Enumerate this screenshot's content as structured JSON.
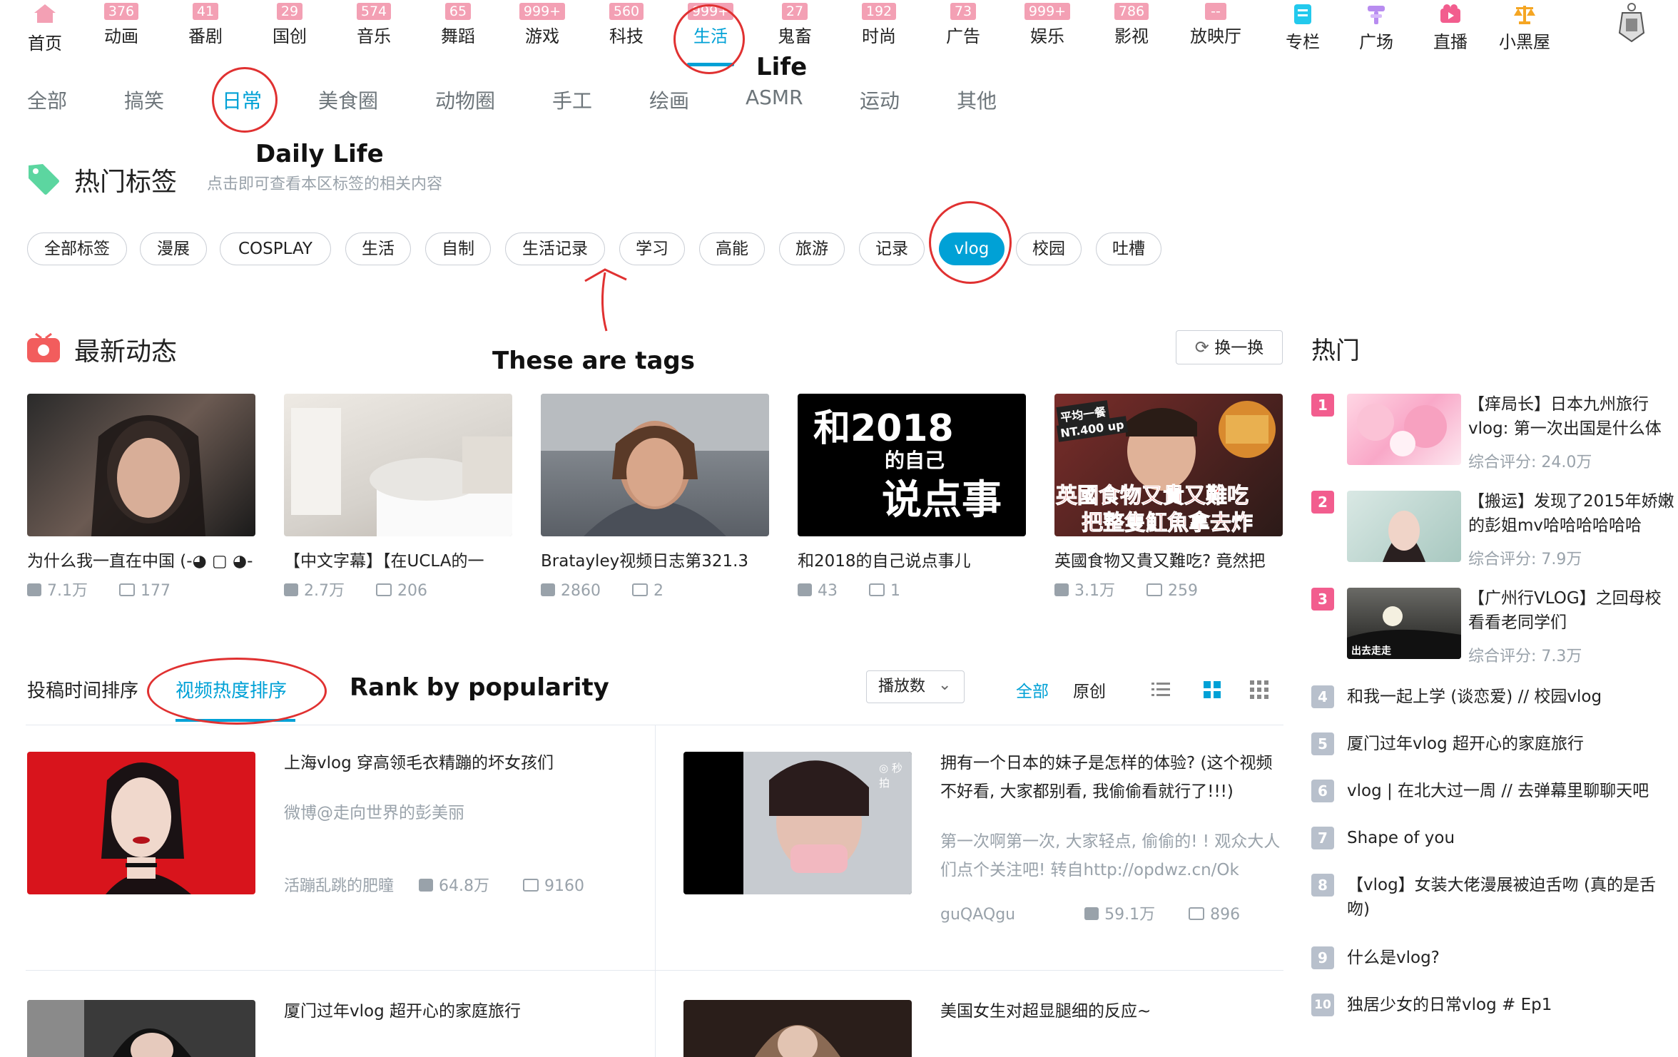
{
  "nav": {
    "items": [
      {
        "label": "首页",
        "badge": ""
      },
      {
        "label": "动画",
        "badge": "376"
      },
      {
        "label": "番剧",
        "badge": "41"
      },
      {
        "label": "国创",
        "badge": "29"
      },
      {
        "label": "音乐",
        "badge": "574"
      },
      {
        "label": "舞蹈",
        "badge": "65"
      },
      {
        "label": "游戏",
        "badge": "999+"
      },
      {
        "label": "科技",
        "badge": "560"
      },
      {
        "label": "生活",
        "badge": "999+"
      },
      {
        "label": "鬼畜",
        "badge": "27"
      },
      {
        "label": "时尚",
        "badge": "192"
      },
      {
        "label": "广告",
        "badge": "73"
      },
      {
        "label": "娱乐",
        "badge": "999+"
      },
      {
        "label": "影视",
        "badge": "786"
      },
      {
        "label": "放映厅",
        "badge": "--"
      },
      {
        "label": "专栏",
        "badge": ""
      },
      {
        "label": "广场",
        "badge": ""
      },
      {
        "label": "直播",
        "badge": ""
      },
      {
        "label": "小黑屋",
        "badge": ""
      }
    ],
    "active_index": 8,
    "accent_color": "#00a1d6",
    "badge_color": "#f3a0b4"
  },
  "subnav": [
    "全部",
    "搞笑",
    "日常",
    "美食圈",
    "动物圈",
    "手工",
    "绘画",
    "ASMR",
    "运动",
    "其他"
  ],
  "annotations": {
    "life": "Life",
    "daily_life": "Daily Life",
    "tags_note": "These are tags",
    "rank_note": "Rank by popularity"
  },
  "hot_tags": {
    "title": "热门标签",
    "subtitle": "点击即可查看本区标签的相关内容",
    "tags": [
      "全部标签",
      "漫展",
      "COSPLAY",
      "生活",
      "自制",
      "生活记录",
      "学习",
      "高能",
      "旅游",
      "记录",
      "vlog",
      "校园",
      "吐槽"
    ],
    "active": "vlog"
  },
  "latest": {
    "title": "最新动态",
    "refresh_label": "换一换",
    "cards": [
      {
        "title": "为什么我一直在中国 (-◕ ▢ ◕-",
        "plays": "7.1万",
        "danmaku": "177"
      },
      {
        "title": "【中文字幕】【在UCLA的一",
        "plays": "2.7万",
        "danmaku": "206"
      },
      {
        "title": "Bratayley视频日志第321.3",
        "plays": "2860",
        "danmaku": "2"
      },
      {
        "title": "和2018的自己说点事儿",
        "plays": "43",
        "danmaku": "1"
      },
      {
        "title": "英國食物又貴又難吃? 竟然把",
        "plays": "3.1万",
        "danmaku": "259"
      }
    ],
    "thumb_text": {
      "t4_line1": "和2018",
      "t4_line2": "的自己",
      "t4_line3": "说点事",
      "t5_tag1": "平均一餐",
      "t5_tag2": "NT.400 up",
      "t5_line1": "英國食物又貴又難吃",
      "t5_line2": "把整隻魟魚拿去炸"
    }
  },
  "sort": {
    "by_time": "投稿时间排序",
    "by_popularity": "视频热度排序",
    "dropdown": "播放数",
    "filter_all": "全部",
    "filter_original": "原创"
  },
  "list": [
    {
      "title": "上海vlog 穿高领毛衣精蹦的坏女孩们",
      "desc": "微博@走向世界的彭美丽",
      "author": "活蹦乱跳的肥瞳",
      "plays": "64.8万",
      "danmaku": "9160"
    },
    {
      "title": "拥有一个日本的妹子是怎样的体验? (这个视频不好看, 大家都别看, 我偷偷看就行了!!!)",
      "desc": "第一次啊第一次, 大家轻点, 偷偷的! ! 观众大人们点个关注吧! 转自http://opdwz.cn/Ok",
      "author": "guQAQgu",
      "plays": "59.1万",
      "danmaku": "896",
      "thumb_mark": "◎ 秒拍"
    },
    {
      "title": "厦门过年vlog 超开心的家庭旅行"
    },
    {
      "title": "美国女生对超显腿细的反应~"
    }
  ],
  "hot": {
    "title": "热门",
    "top": [
      {
        "rank": "1",
        "title": "【痒局长】日本九州旅行vlog: 第一次出国是什么体",
        "score": "综合评分: 24.0万"
      },
      {
        "rank": "2",
        "title": "【搬运】发现了2015年娇嫩的彭姐mv哈哈哈哈哈哈",
        "score": "综合评分: 7.9万"
      },
      {
        "rank": "3",
        "title": "【广州行VLOG】之回母校看看老同学们",
        "score": "综合评分: 7.3万",
        "thumb_caption": "出去走走"
      }
    ],
    "rest": [
      {
        "rank": "4",
        "title": "和我一起上学 (谈恋爱) // 校园vlog"
      },
      {
        "rank": "5",
        "title": "厦门过年vlog 超开心的家庭旅行"
      },
      {
        "rank": "6",
        "title": "vlog | 在北大过一周 // 去弹幕里聊聊天吧"
      },
      {
        "rank": "7",
        "title": "Shape of you"
      },
      {
        "rank": "8",
        "title": "【vlog】女装大佬漫展被迫舌吻 (真的是舌吻)"
      },
      {
        "rank": "9",
        "title": "什么是vlog?"
      },
      {
        "rank": "10",
        "title": "独居少女的日常vlog # Ep1"
      }
    ]
  }
}
